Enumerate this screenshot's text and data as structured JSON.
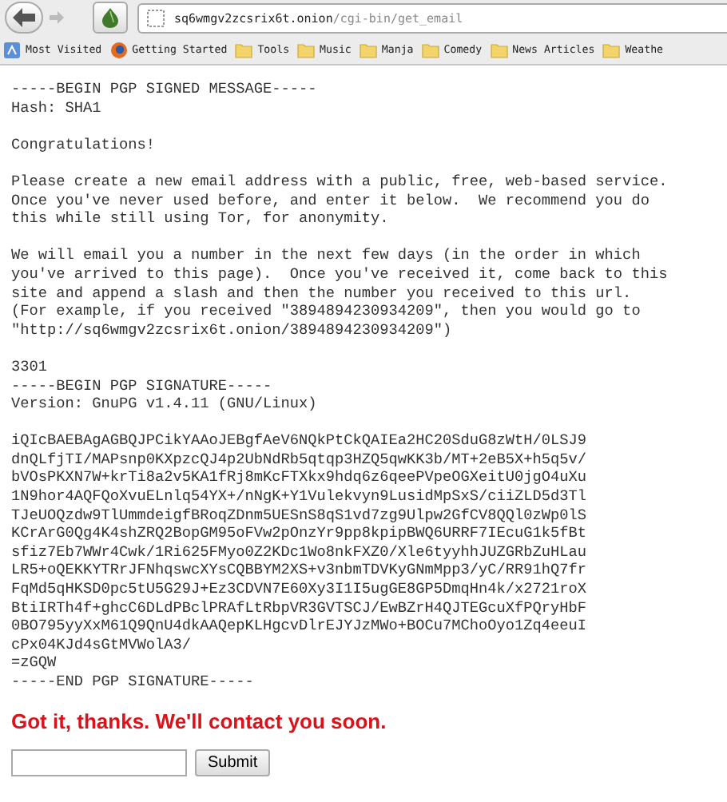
{
  "browser": {
    "url_host": "sq6wmgv2zcsrix6t.onion",
    "url_path": "/cgi-bin/get_email",
    "bookmarks": [
      {
        "label": "Most Visited",
        "kind": "smart"
      },
      {
        "label": "Getting Started",
        "kind": "globe"
      },
      {
        "label": "Tools",
        "kind": "folder"
      },
      {
        "label": "Music",
        "kind": "folder"
      },
      {
        "label": "Manja",
        "kind": "folder"
      },
      {
        "label": "Comedy",
        "kind": "folder"
      },
      {
        "label": "News Articles",
        "kind": "folder"
      },
      {
        "label": "Weathe",
        "kind": "folder"
      }
    ]
  },
  "message_blocks": [
    [
      "-----BEGIN PGP SIGNED MESSAGE-----",
      "Hash: SHA1"
    ],
    [
      "Congratulations!"
    ],
    [
      "Please create a new email address with a public, free, web-based service.",
      "Once you've never used before, and enter it below.  We recommend you do",
      "this while still using Tor, for anonymity."
    ],
    [
      "We will email you a number in the next few days (in the order in which",
      "you've arrived to this page).  Once you've received it, come back to this",
      "site and append a slash and then the number you received to this url.",
      "(For example, if you received \"3894894230934209\", then you would go to",
      "\"http://sq6wmgv2zcsrix6t.onion/3894894230934209\")"
    ],
    [
      "3301",
      "-----BEGIN PGP SIGNATURE-----",
      "Version: GnuPG v1.4.11 (GNU/Linux)"
    ],
    [
      "iQIcBAEBAgAGBQJPCikYAAoJEBgfAeV6NQkPtCkQAIEa2HC20SduG8zWtH/0LSJ9",
      "dnQLfjTI/MAPsnp0KXpzcQJ4p2UbNdRb5qtqp3HZQ5qwKK3b/MT+2eB5X+h5q5v/",
      "bVOsPKXN7W+krTi8a2v5KA1fRj8mKcFTXkx9hdq6z6qeePVpeOGXeitU0jgO4uXu",
      "1N9hor4AQFQoXvuELnlq54YX+/nNgK+Y1Vulekvyn9LusidMpSxS/ciiZLD5d3Tl",
      "TJeUOQzdw9TlUmmdeigfBRoqZDnm5UESnS8qS1vd7zg9Ulpw2GfCV8QQl0zWp0lS",
      "KCrArG0Qg4K4shZRQ2BopGM95oFVw2pOnzYr9pp8kpipBWQ6URRF7IEcuG1k5fBt",
      "sfiz7Eb7WWr4Cwk/1Ri625FMyo0Z2KDc1Wo8nkFXZ0/Xle6tyyhhJUZGRbZuHLau",
      "LR5+oQEKKYTRrJFNhqswcXYsCQBBYM2XS+v3nbmTDVKyGNmMpp3/yC/RR91hQ7fr",
      "FqMd5qHKSD0pc5tU5G29J+Ez3CDVN7E60Xy3I1I5ugGE8GP5DmqHn4k/x2721roX",
      "BtiIRTh4f+ghcC6DLdPBclPRAfLtRbpVR3GVTSCJ/EwBZrH4QJTEGcuXfPQryHbF",
      "0BO795yyXxM61Q9QnU4dkAAQepKLHgcvDlrEJYJzMWo+BOCu7MChoOyo1Zq4eeuI",
      "cPx04KJd4sGtMVWolA3/",
      "=zGQW",
      "-----END PGP SIGNATURE-----"
    ]
  ],
  "confirmation": "Got it, thanks. We'll contact you soon.",
  "form": {
    "submit": "Submit"
  }
}
